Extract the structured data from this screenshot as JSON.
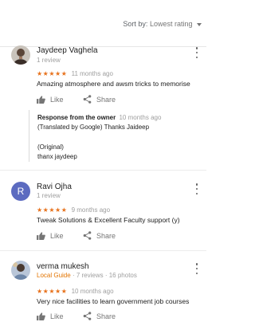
{
  "sort": {
    "label": "Sort by:",
    "value": "Lowest rating"
  },
  "reviews": [
    {
      "name": "Jaydeep Vaghela",
      "meta": "1 review",
      "stars": "★★★★★",
      "time": "11 months ago",
      "text": "Amazing atmosphere and awsm tricks to memorise",
      "like": "Like",
      "share": "Share",
      "owner": {
        "title": "Response from the owner",
        "time": "10 months ago",
        "line1": "(Translated by Google) Thanks Jaideep",
        "line2": "(Original)",
        "line3": "thanx jaydeep"
      }
    },
    {
      "name": "Ravi Ojha",
      "initial": "R",
      "avatar_color": "#5c6bc0",
      "meta": "1 review",
      "stars": "★★★★★",
      "time": "9 months ago",
      "text": "Tweak Solutions & Excellent Faculty support (y)",
      "like": "Like",
      "share": "Share"
    },
    {
      "name": "verma mukesh",
      "guide": "Local Guide",
      "meta": "· 7 reviews · 16 photos",
      "stars": "★★★★★",
      "time": "10 months ago",
      "text": "Very nice facilities to learn government job courses",
      "like": "Like",
      "share": "Share"
    }
  ],
  "colors": {
    "star": "#e7711b",
    "local_guide": "#e37400"
  }
}
